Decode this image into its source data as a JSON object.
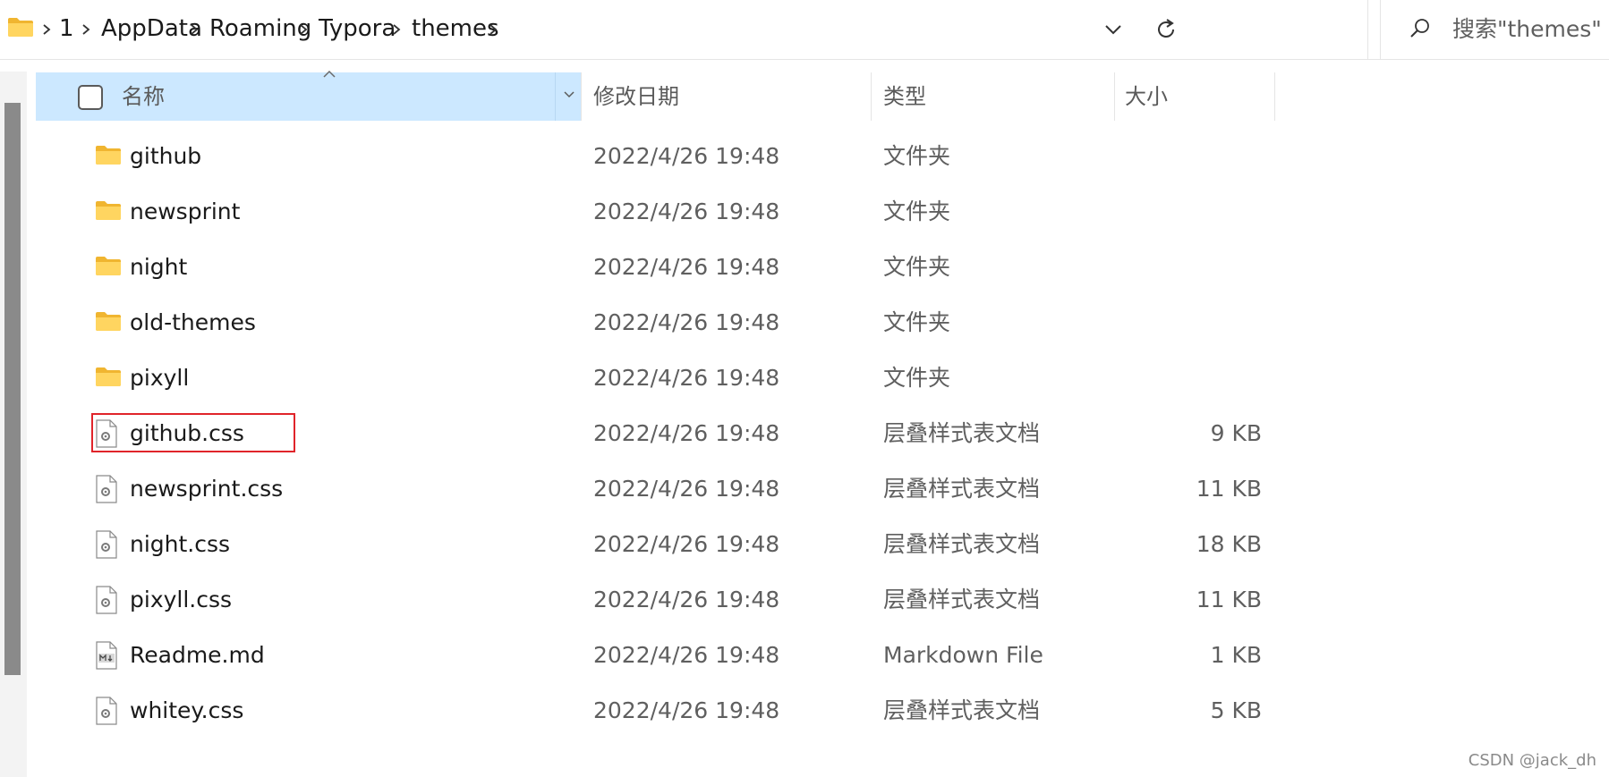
{
  "breadcrumb": [
    "1",
    "AppData",
    "Roaming",
    "Typora",
    "themes"
  ],
  "search": {
    "placeholder": "搜索\"themes\""
  },
  "columns": {
    "name": "名称",
    "date": "修改日期",
    "type": "类型",
    "size": "大小"
  },
  "files": [
    {
      "name": "github",
      "date": "2022/4/26 19:48",
      "type": "文件夹",
      "size": "",
      "icon": "folder-icon"
    },
    {
      "name": "newsprint",
      "date": "2022/4/26 19:48",
      "type": "文件夹",
      "size": "",
      "icon": "folder-icon"
    },
    {
      "name": "night",
      "date": "2022/4/26 19:48",
      "type": "文件夹",
      "size": "",
      "icon": "folder-icon"
    },
    {
      "name": "old-themes",
      "date": "2022/4/26 19:48",
      "type": "文件夹",
      "size": "",
      "icon": "folder-icon"
    },
    {
      "name": "pixyll",
      "date": "2022/4/26 19:48",
      "type": "文件夹",
      "size": "",
      "icon": "folder-icon"
    },
    {
      "name": "github.css",
      "date": "2022/4/26 19:48",
      "type": "层叠样式表文档",
      "size": "9 KB",
      "icon": "css-file-icon"
    },
    {
      "name": "newsprint.css",
      "date": "2022/4/26 19:48",
      "type": "层叠样式表文档",
      "size": "11 KB",
      "icon": "css-file-icon"
    },
    {
      "name": "night.css",
      "date": "2022/4/26 19:48",
      "type": "层叠样式表文档",
      "size": "18 KB",
      "icon": "css-file-icon"
    },
    {
      "name": "pixyll.css",
      "date": "2022/4/26 19:48",
      "type": "层叠样式表文档",
      "size": "11 KB",
      "icon": "css-file-icon"
    },
    {
      "name": "Readme.md",
      "date": "2022/4/26 19:48",
      "type": "Markdown File",
      "size": "1 KB",
      "icon": "markdown-file-icon"
    },
    {
      "name": "whitey.css",
      "date": "2022/4/26 19:48",
      "type": "层叠样式表文档",
      "size": "5 KB",
      "icon": "css-file-icon"
    }
  ],
  "highlighted_file": "github.css",
  "watermark": "CSDN @jack_dh",
  "colors": {
    "selection": "#cce8ff",
    "highlight_border": "#e0242a",
    "folder": "#ffc83d"
  }
}
